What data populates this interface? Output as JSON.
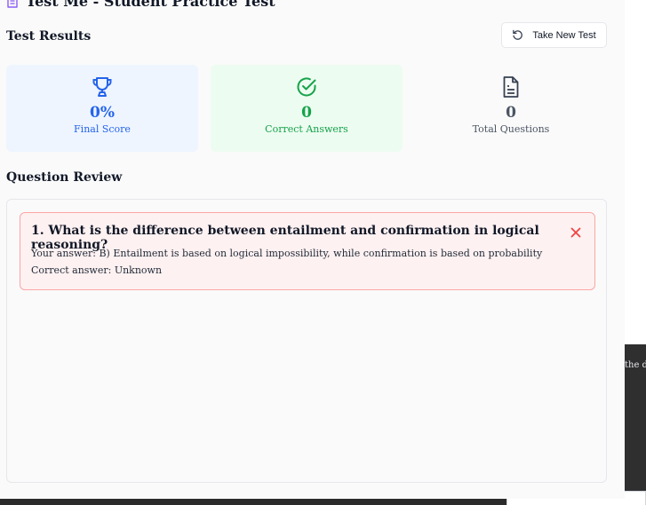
{
  "modal": {
    "title": "Test Me - Student Practice Test"
  },
  "results": {
    "title": "Test Results",
    "new_test_label": "Take New Test"
  },
  "stats": [
    {
      "value": "0%",
      "label": "Final Score",
      "icon": "trophy-icon"
    },
    {
      "value": "0",
      "label": "Correct Answers",
      "icon": "check-circle-icon"
    },
    {
      "value": "0",
      "label": "Total Questions",
      "icon": "document-icon"
    }
  ],
  "review": {
    "title": "Question Review",
    "questions": [
      {
        "text": "1. What is the difference between entailment and confirmation in logical reasoning?",
        "your_answer": "Your answer: B) Entailment is based on logical impossibility, while confirmation is based on probability",
        "correct_answer": "Correct answer: Unknown",
        "status_icon": "x-icon"
      }
    ]
  },
  "backdrop": {
    "partial_text": "the de"
  },
  "colors": {
    "blue": "#2563eb",
    "green": "#16a34a",
    "gray": "#4b5563",
    "red": "#ef4444",
    "purple": "#8b5cf6"
  }
}
